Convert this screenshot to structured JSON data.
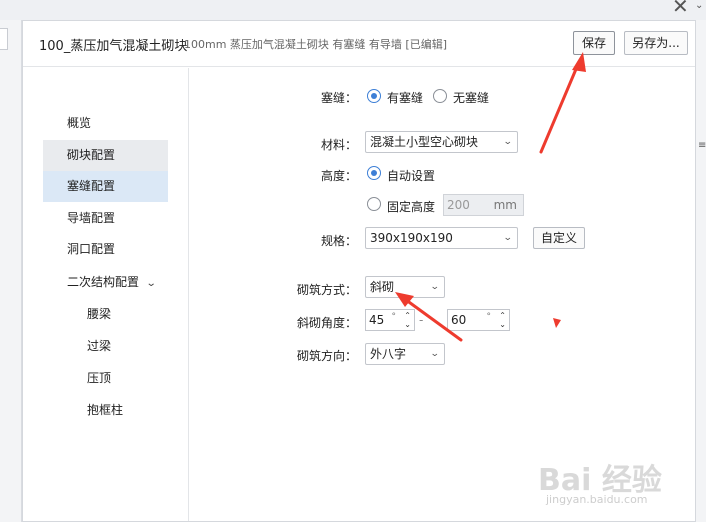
{
  "window": {
    "close_glyph": "✕",
    "caret_glyph": "⌄"
  },
  "right_stub_glyph": "≡",
  "header": {
    "title": "100_蒸压加气混凝土砌块",
    "subtitle": "100mm 蒸压加气混凝土砌块 有塞缝 有导墙 [已编辑]",
    "save_label": "保存",
    "save_as_label": "另存为..."
  },
  "sidebar": {
    "items": [
      {
        "label": "概览"
      },
      {
        "label": "砌块配置"
      },
      {
        "label": "塞缝配置"
      },
      {
        "label": "导墙配置"
      },
      {
        "label": "洞口配置"
      },
      {
        "label": "二次结构配置",
        "chevron": "⌄"
      },
      {
        "label": "腰梁"
      },
      {
        "label": "过梁"
      },
      {
        "label": "压顶"
      },
      {
        "label": "抱框柱"
      }
    ]
  },
  "form": {
    "caulk": {
      "label": "塞缝：",
      "opt_yes": "有塞缝",
      "opt_no": "无塞缝",
      "selected": "有塞缝"
    },
    "material": {
      "label": "材料：",
      "value": "混凝土小型空心砌块"
    },
    "height": {
      "label": "高度：",
      "opt_auto": "自动设置",
      "opt_fixed": "固定高度",
      "selected": "自动设置",
      "fixed_value": "200",
      "unit": "mm"
    },
    "spec": {
      "label": "规格：",
      "value": "390x190x190",
      "custom_label": "自定义"
    },
    "method": {
      "label": "砌筑方式：",
      "value": "斜砌"
    },
    "angle": {
      "label": "斜砌角度：",
      "value1": "45",
      "value2": "60",
      "degree": "°",
      "separator": "-"
    },
    "direction": {
      "label": "砌筑方向：",
      "value": "外八字"
    }
  },
  "arrows": {
    "color": "#ee3b2e"
  },
  "watermark": {
    "brand": "Bai 经验",
    "url": "jingyan.baidu.com"
  }
}
